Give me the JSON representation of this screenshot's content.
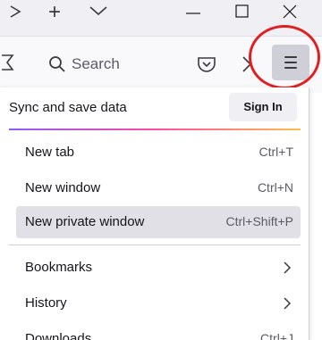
{
  "tabstrip": {
    "new_tab_symbol": "+",
    "list_all_tabs_icon": "chevron-down-icon"
  },
  "window_controls": {
    "minimize_icon": "minimize-icon",
    "maximize_icon": "maximize-icon",
    "close_icon": "close-icon"
  },
  "toolbar": {
    "search_placeholder": "Search",
    "pocket_icon": "pocket-icon",
    "overflow_icon": "chevron-right-double-icon",
    "menu_icon": "hamburger-menu-icon"
  },
  "menu": {
    "sync_label": "Sync and save data",
    "sign_in_label": "Sign In",
    "items": [
      {
        "label": "New tab",
        "shortcut": "Ctrl+T"
      },
      {
        "label": "New window",
        "shortcut": "Ctrl+N"
      },
      {
        "label": "New private window",
        "shortcut": "Ctrl+Shift+P"
      },
      {
        "label": "Bookmarks",
        "shortcut": ""
      },
      {
        "label": "History",
        "shortcut": ""
      },
      {
        "label": "Downloads",
        "shortcut": "Ctrl+J"
      }
    ]
  },
  "colors": {
    "highlight_circle": "#e02020",
    "active_item_bg": "#e0e0e6",
    "menu_button_bg": "#cfcfd8"
  }
}
